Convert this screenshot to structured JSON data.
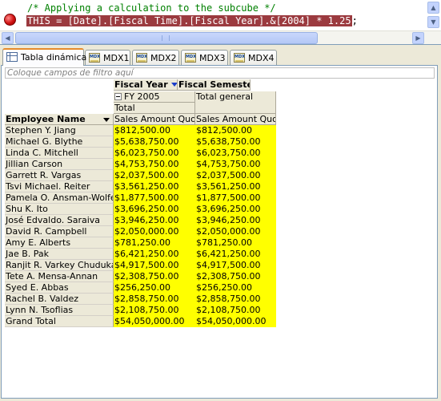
{
  "editor": {
    "comment": "/* Applying a calculation to the subcube */",
    "statement": "THIS = [Date].[Fiscal Time].[Fiscal Year].&[2004] * 1.25",
    "statement_end": ";"
  },
  "tabs": [
    {
      "label": "Tabla dinámica",
      "icon": "pivot-table-icon",
      "active": true
    },
    {
      "label": "MDX1",
      "icon": "mdx-query-icon"
    },
    {
      "label": "MDX2",
      "icon": "mdx-query-icon"
    },
    {
      "label": "MDX3",
      "icon": "mdx-query-icon"
    },
    {
      "label": "MDX4",
      "icon": "mdx-query-icon"
    }
  ],
  "pivot": {
    "filter_placeholder": "Coloque campos de filtro aquí",
    "column_fields": [
      "Fiscal Year",
      "Fiscal Semester"
    ],
    "year_member": "FY 2005",
    "year_total": "Total",
    "grand_total_col": "Total general",
    "measure": "Sales Amount Quota",
    "row_field": "Employee Name",
    "rows": [
      {
        "name": "Stephen Y. Jiang",
        "fy2005": "$812,500.00",
        "total": "$812,500.00"
      },
      {
        "name": "Michael G. Blythe",
        "fy2005": "$5,638,750.00",
        "total": "$5,638,750.00"
      },
      {
        "name": "Linda C. Mitchell",
        "fy2005": "$6,023,750.00",
        "total": "$6,023,750.00"
      },
      {
        "name": "Jillian Carson",
        "fy2005": "$4,753,750.00",
        "total": "$4,753,750.00"
      },
      {
        "name": "Garrett R. Vargas",
        "fy2005": "$2,037,500.00",
        "total": "$2,037,500.00"
      },
      {
        "name": "Tsvi Michael. Reiter",
        "fy2005": "$3,561,250.00",
        "total": "$3,561,250.00"
      },
      {
        "name": "Pamela O. Ansman-Wolfe",
        "fy2005": "$1,877,500.00",
        "total": "$1,877,500.00"
      },
      {
        "name": "Shu K. Ito",
        "fy2005": "$3,696,250.00",
        "total": "$3,696,250.00"
      },
      {
        "name": "José Edvaldo. Saraiva",
        "fy2005": "$3,946,250.00",
        "total": "$3,946,250.00"
      },
      {
        "name": "David R. Campbell",
        "fy2005": "$2,050,000.00",
        "total": "$2,050,000.00"
      },
      {
        "name": "Amy E. Alberts",
        "fy2005": "$781,250.00",
        "total": "$781,250.00"
      },
      {
        "name": "Jae B. Pak",
        "fy2005": "$6,421,250.00",
        "total": "$6,421,250.00"
      },
      {
        "name": "Ranjit R. Varkey Chudukatil",
        "fy2005": "$4,917,500.00",
        "total": "$4,917,500.00"
      },
      {
        "name": "Tete A. Mensa-Annan",
        "fy2005": "$2,308,750.00",
        "total": "$2,308,750.00"
      },
      {
        "name": "Syed E. Abbas",
        "fy2005": "$256,250.00",
        "total": "$256,250.00"
      },
      {
        "name": "Rachel B. Valdez",
        "fy2005": "$2,858,750.00",
        "total": "$2,858,750.00"
      },
      {
        "name": "Lynn N. Tsoflias",
        "fy2005": "$2,108,750.00",
        "total": "$2,108,750.00"
      },
      {
        "name": "Grand Total",
        "fy2005": "$54,050,000.00",
        "total": "$54,050,000.00"
      }
    ]
  },
  "colors": {
    "highlight_cells": "#ffff00",
    "statement_highlight": "#9b3a3f",
    "comment": "#008000",
    "active_tab_accent": "#e68b2c"
  }
}
